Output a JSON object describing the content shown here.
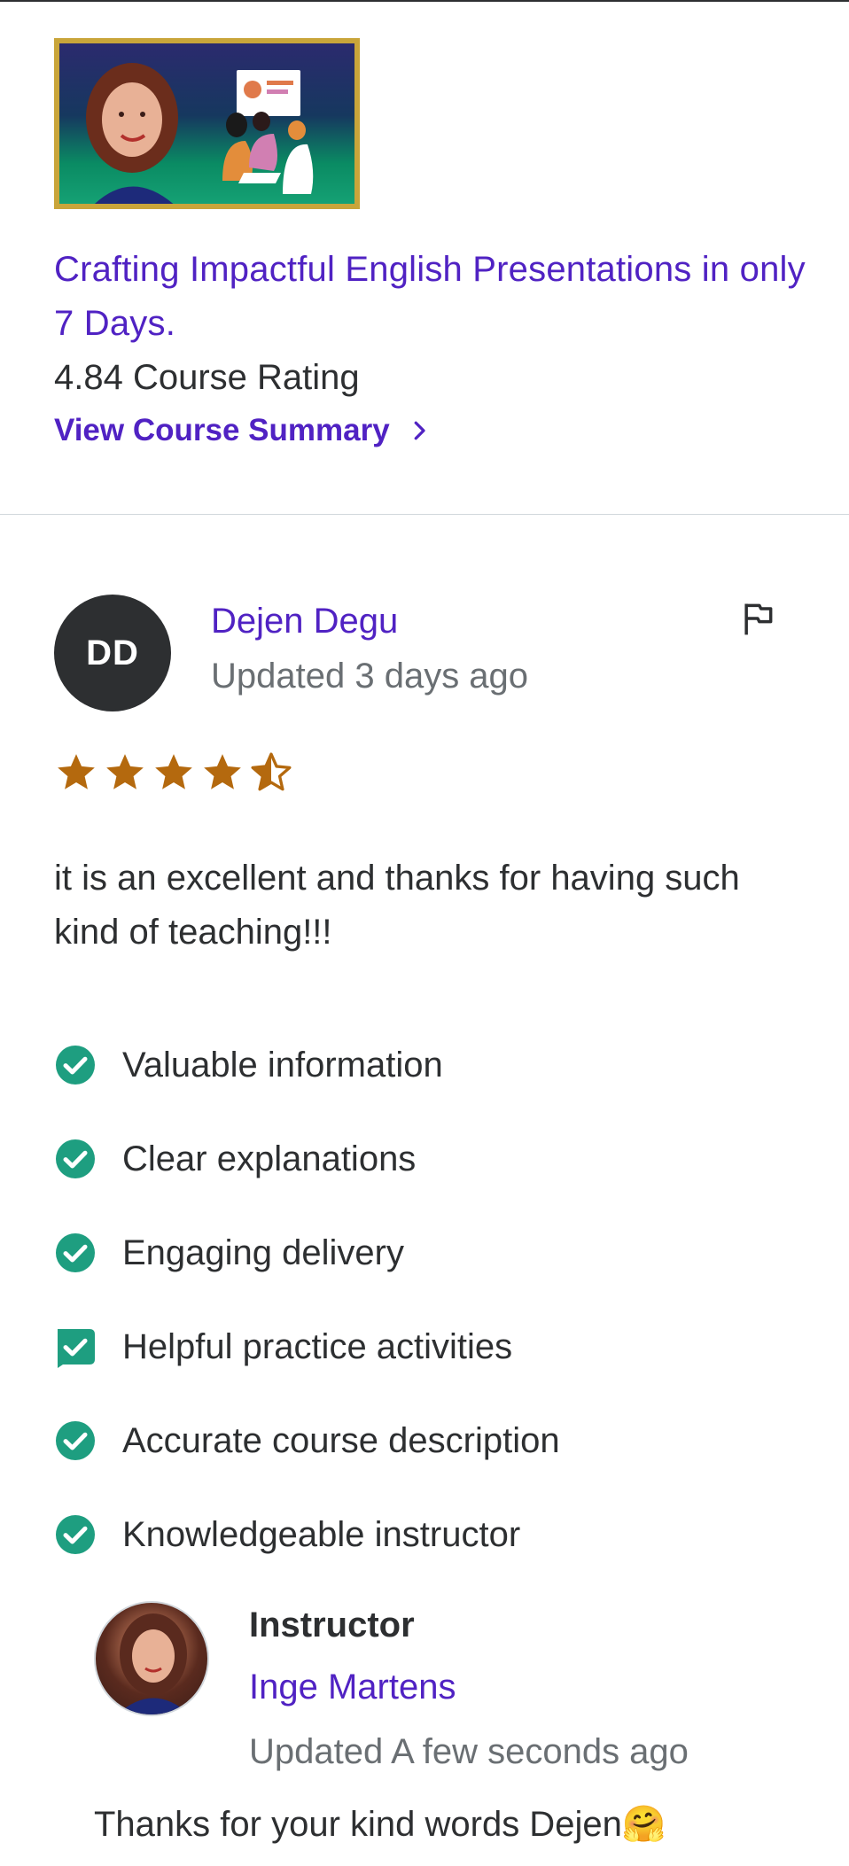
{
  "course": {
    "title": "Crafting Impactful English Presentations in only 7 Days.",
    "rating_text": "4.84 Course Rating",
    "summary_link": "View Course Summary"
  },
  "review": {
    "avatar_initials": "DD",
    "reviewer_name": "Dejen Degu",
    "updated": "Updated 3 days ago",
    "rating": 4.5,
    "text": "it is an excellent and thanks for having such kind of teaching!!!",
    "tags": [
      "Valuable information",
      "Clear explanations",
      "Engaging delivery",
      "Helpful practice activities",
      "Accurate course description",
      "Knowledgeable instructor"
    ]
  },
  "response": {
    "role": "Instructor",
    "name": "Inge Martens",
    "updated": "Updated A few seconds ago",
    "text": "Thanks for your kind words Dejen🤗"
  },
  "colors": {
    "accent": "#5022c3",
    "star": "#b4690e",
    "check": "#1e9e80",
    "text": "#2d2f31",
    "muted": "#6a6f73"
  }
}
